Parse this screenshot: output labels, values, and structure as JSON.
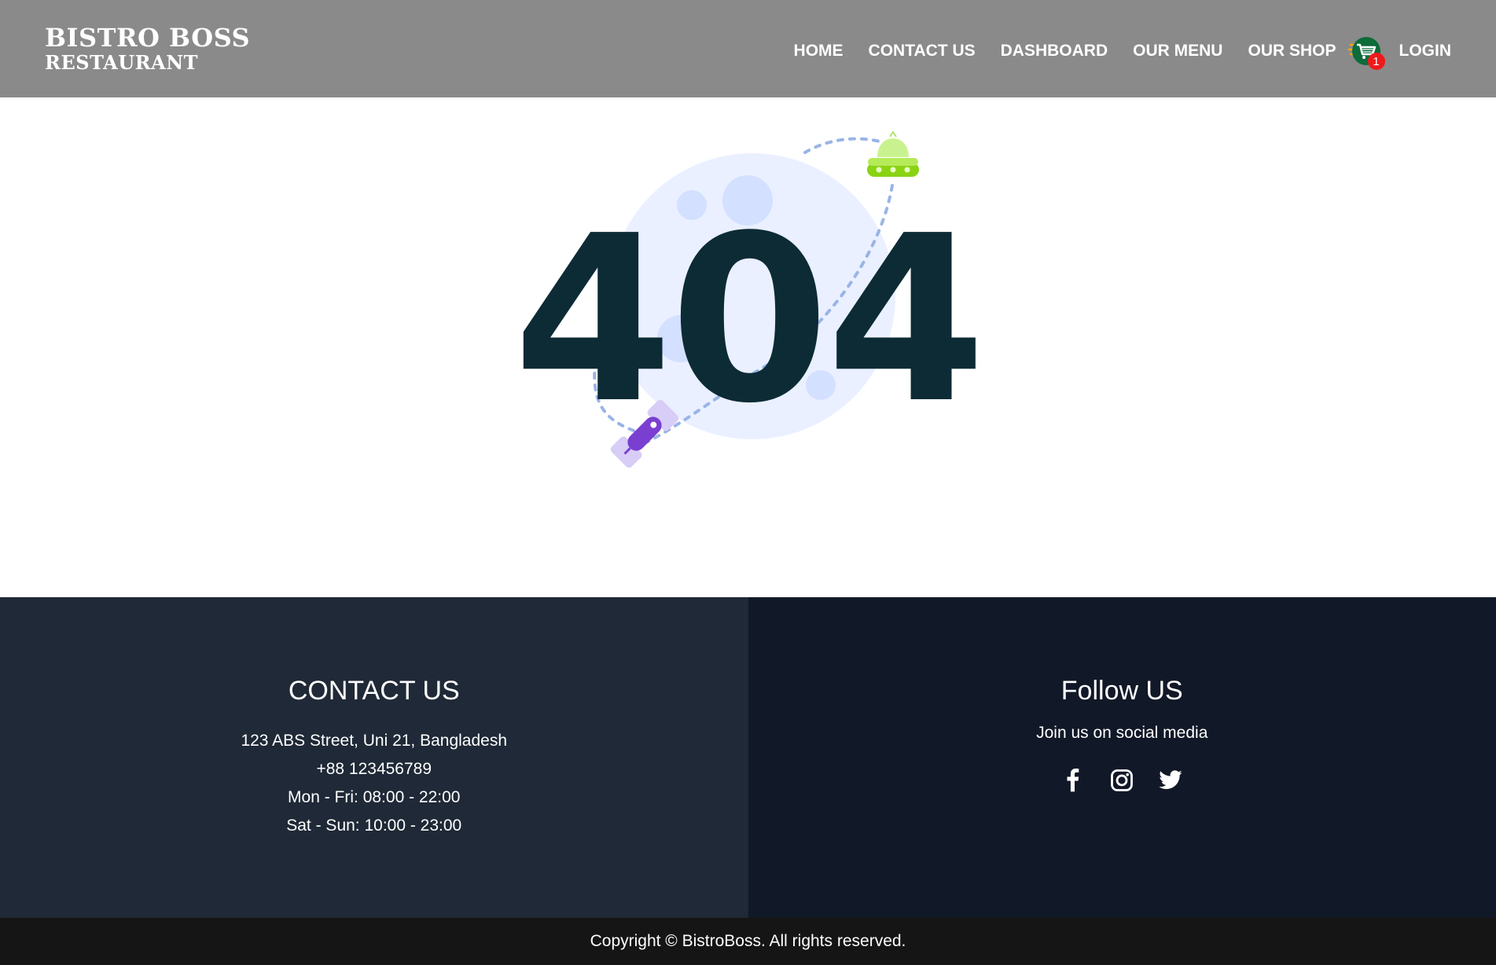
{
  "navbar": {
    "brand_line1": "BISTRO BOSS",
    "brand_line2": "RESTAURANT",
    "links": [
      "HOME",
      "CONTACT US",
      "DASHBOARD",
      "OUR MENU",
      "OUR SHOP"
    ],
    "cart_icon": "shopping-cart-icon",
    "cart_count": "1",
    "login_label": "LOGIN"
  },
  "not_found": {
    "code": "404",
    "illustration": [
      "moon",
      "ufo",
      "satellite",
      "dashed-orbit"
    ]
  },
  "footer": {
    "contact": {
      "heading": "CONTACT US",
      "address": "123 ABS Street, Uni 21, Bangladesh",
      "phone": "+88 123456789",
      "weekday_hours": "Mon - Fri: 08:00 - 22:00",
      "weekend_hours": "Sat - Sun: 10:00 - 23:00"
    },
    "follow": {
      "heading": "Follow US",
      "subtitle": "Join us on social media",
      "icons": [
        "facebook-icon",
        "instagram-icon",
        "twitter-icon"
      ]
    },
    "copyright": "Copyright © BistroBoss. All rights reserved."
  },
  "colors": {
    "navbar_bg": "#8a8a8a",
    "code_text": "#0c2b35",
    "footer_left_bg": "#1f2937",
    "footer_right_bg": "#111827",
    "copyright_bg": "#151515",
    "cart_badge": "#ef1a1a"
  }
}
